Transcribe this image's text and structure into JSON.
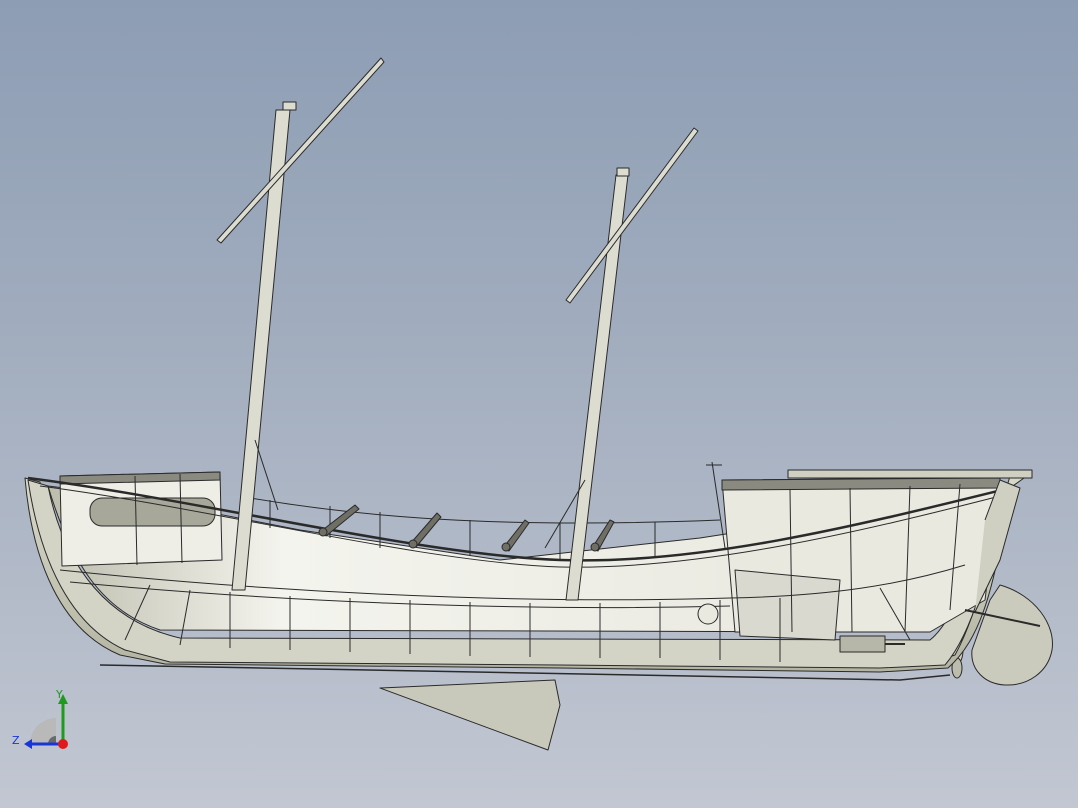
{
  "viewport": {
    "background_top": "#8d9db4",
    "background_bottom": "#c2c7d2"
  },
  "model": {
    "subject": "ship",
    "hull_color": "#cfcfc1",
    "hull_shadow_color": "#a7a796",
    "interior_color": "#f3f3ec",
    "edge_color": "#2a2a2a",
    "mast_color": "#dcdcd0"
  },
  "triad": {
    "y_label": "Y",
    "z_label": "Z",
    "y_color": "#1f9a1f",
    "z_color": "#1836d6",
    "x_color": "#e01a1a",
    "icon": "coordinate-triad-icon"
  }
}
